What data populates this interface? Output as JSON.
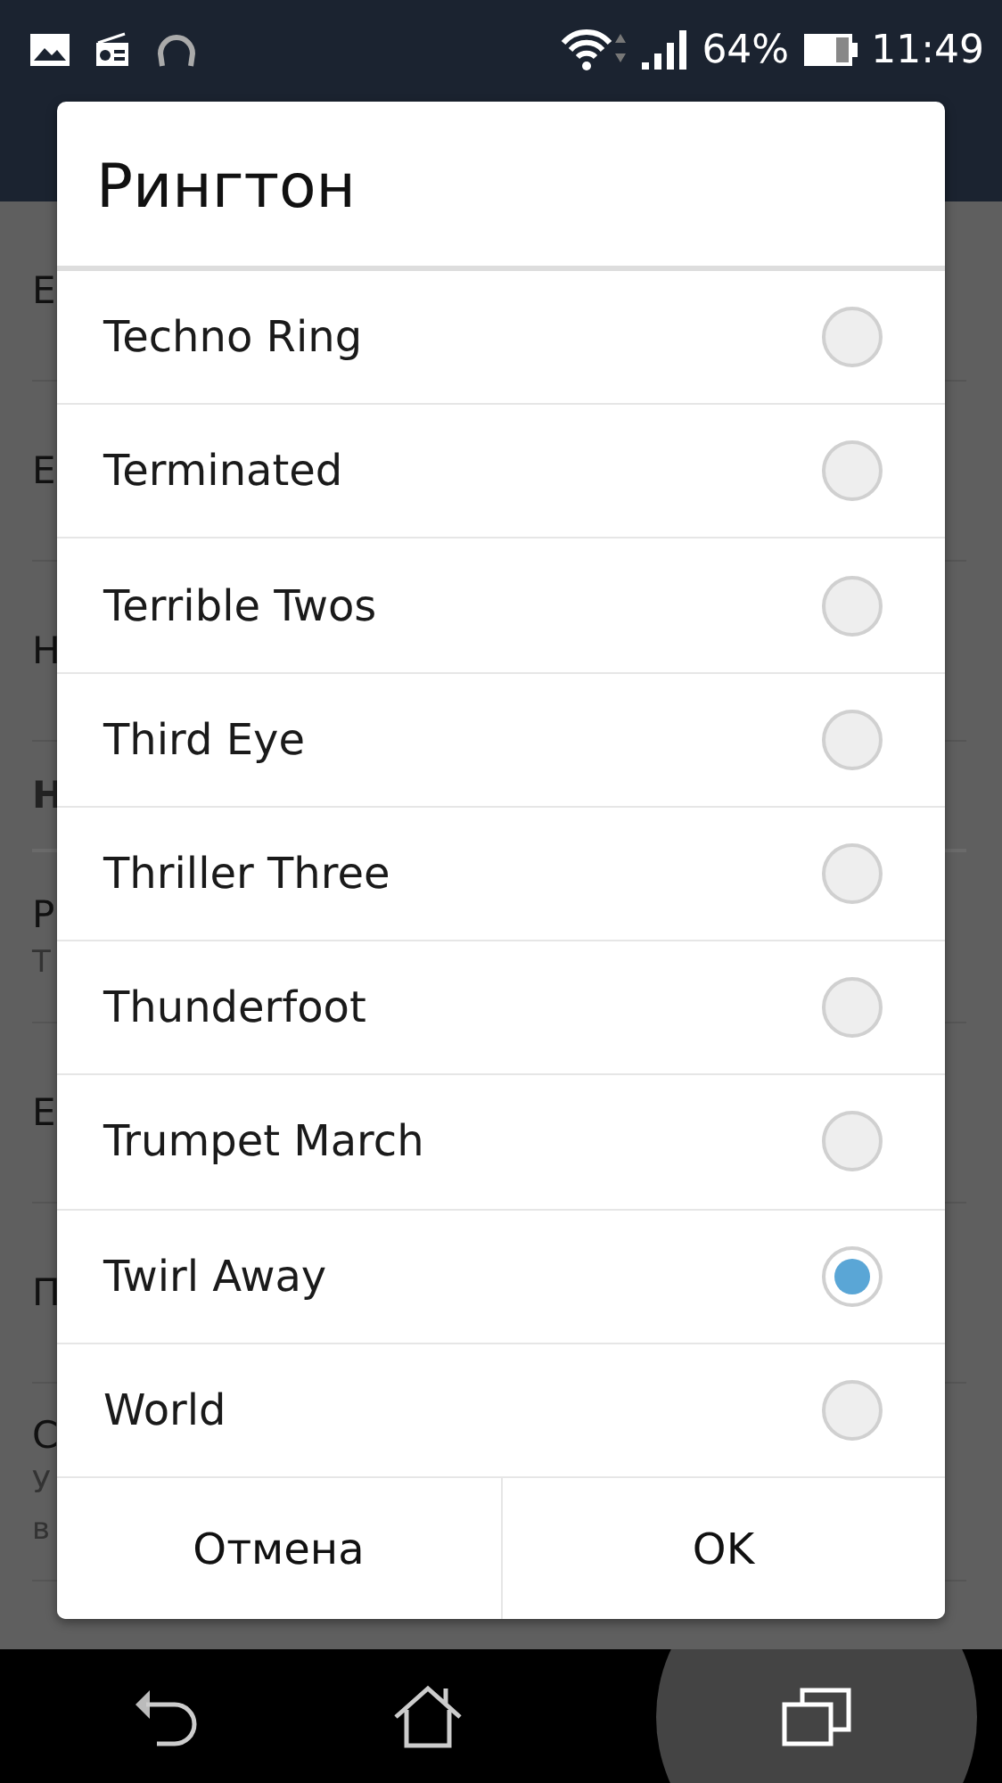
{
  "status_bar": {
    "battery": "64%",
    "time": "11:49"
  },
  "background_list": [
    {
      "kind": "item",
      "title": "Е"
    },
    {
      "kind": "item",
      "title": "Е"
    },
    {
      "kind": "item",
      "title": "Н"
    },
    {
      "kind": "header",
      "title": "Н"
    },
    {
      "kind": "item",
      "title": "Р",
      "subtitle": "Т"
    },
    {
      "kind": "item",
      "title": "Е"
    },
    {
      "kind": "item",
      "title": "П"
    },
    {
      "kind": "item",
      "title": "С",
      "subtitle": "У",
      "subtitle_2": "в"
    }
  ],
  "dialog": {
    "title": "Рингтон",
    "options": [
      {
        "label": "Techno Ring",
        "selected": false
      },
      {
        "label": "Terminated",
        "selected": false
      },
      {
        "label": "Terrible Twos",
        "selected": false
      },
      {
        "label": "Third Eye",
        "selected": false
      },
      {
        "label": "Thriller Three",
        "selected": false
      },
      {
        "label": "Thunderfoot",
        "selected": false
      },
      {
        "label": "Trumpet March",
        "selected": false
      },
      {
        "label": "Twirl Away",
        "selected": true
      },
      {
        "label": "World",
        "selected": false
      }
    ],
    "buttons": [
      "Отмена",
      "OK"
    ]
  }
}
